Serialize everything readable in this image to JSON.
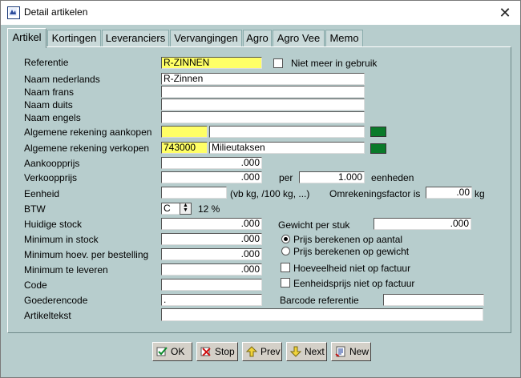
{
  "window": {
    "title": "Detail artikelen",
    "close_glyph": "✕"
  },
  "tabs": [
    "Artikel",
    "Kortingen",
    "Leveranciers",
    "Vervangingen",
    "Agro",
    "Agro Vee",
    "Memo"
  ],
  "labels": {
    "referentie": "Referentie",
    "naam_nl": "Naam nederlands",
    "naam_fr": "Naam frans",
    "naam_du": "Naam duits",
    "naam_en": "Naam engels",
    "rek_aankopen": "Algemene rekening aankopen",
    "rek_verkopen": "Algemene rekening verkopen",
    "aankoopprijs": "Aankoopprijs",
    "verkoopprijs": "Verkoopprijs",
    "eenheid": "Eenheid",
    "btw": "BTW",
    "huidige_stock": "Huidige stock",
    "minimum_stock": "Minimum in stock",
    "minimum_bestelling": "Minimum hoev. per bestelling",
    "minimum_leveren": "Minimum te leveren",
    "code": "Code",
    "goederencode": "Goederencode",
    "artikeltekst": "Artikeltekst",
    "niet_meer": "Niet meer in gebruik",
    "per": "per",
    "eenheden": "eenheden",
    "eenheid_hint": "(vb kg, /100 kg, ...)",
    "omrekening": "Omrekeningsfactor is",
    "kg": "kg",
    "btw_pct": "12 %",
    "gewicht": "Gewicht  per stuk",
    "prijs_aantal": "Prijs berekenen op aantal",
    "prijs_gewicht": "Prijs berekenen op gewicht",
    "hoeveelheid_factuur": "Hoeveelheid niet op factuur",
    "eenheidsprijs_factuur": "Eenheidsprijs niet op factuur",
    "barcode": "Barcode referentie"
  },
  "values": {
    "referentie": "R-ZINNEN",
    "naam_nl": "R-Zinnen",
    "naam_fr": "",
    "naam_du": "",
    "naam_en": "",
    "rek_aankopen_code": "",
    "rek_aankopen_naam": "",
    "rek_verkopen_code": "743000",
    "rek_verkopen_naam": "Milieutaksen",
    "aankoopprijs": ".000",
    "verkoopprijs": ".000",
    "per_eenheden": "1.000",
    "eenheid": "",
    "omrekening": ".00",
    "btw": "C",
    "huidige_stock": ".000",
    "gewicht": ".000",
    "minimum_stock": ".000",
    "minimum_bestelling": ".000",
    "minimum_leveren": ".000",
    "code": "",
    "goederencode": ".",
    "barcode": "",
    "artikeltekst": ""
  },
  "buttons": [
    "OK",
    "Stop",
    "Prev",
    "Next",
    "New"
  ],
  "colors": {
    "panel": "#b7cdcd",
    "highlight_field": "#ffff66",
    "lookup_button": "#0a7a2a"
  }
}
